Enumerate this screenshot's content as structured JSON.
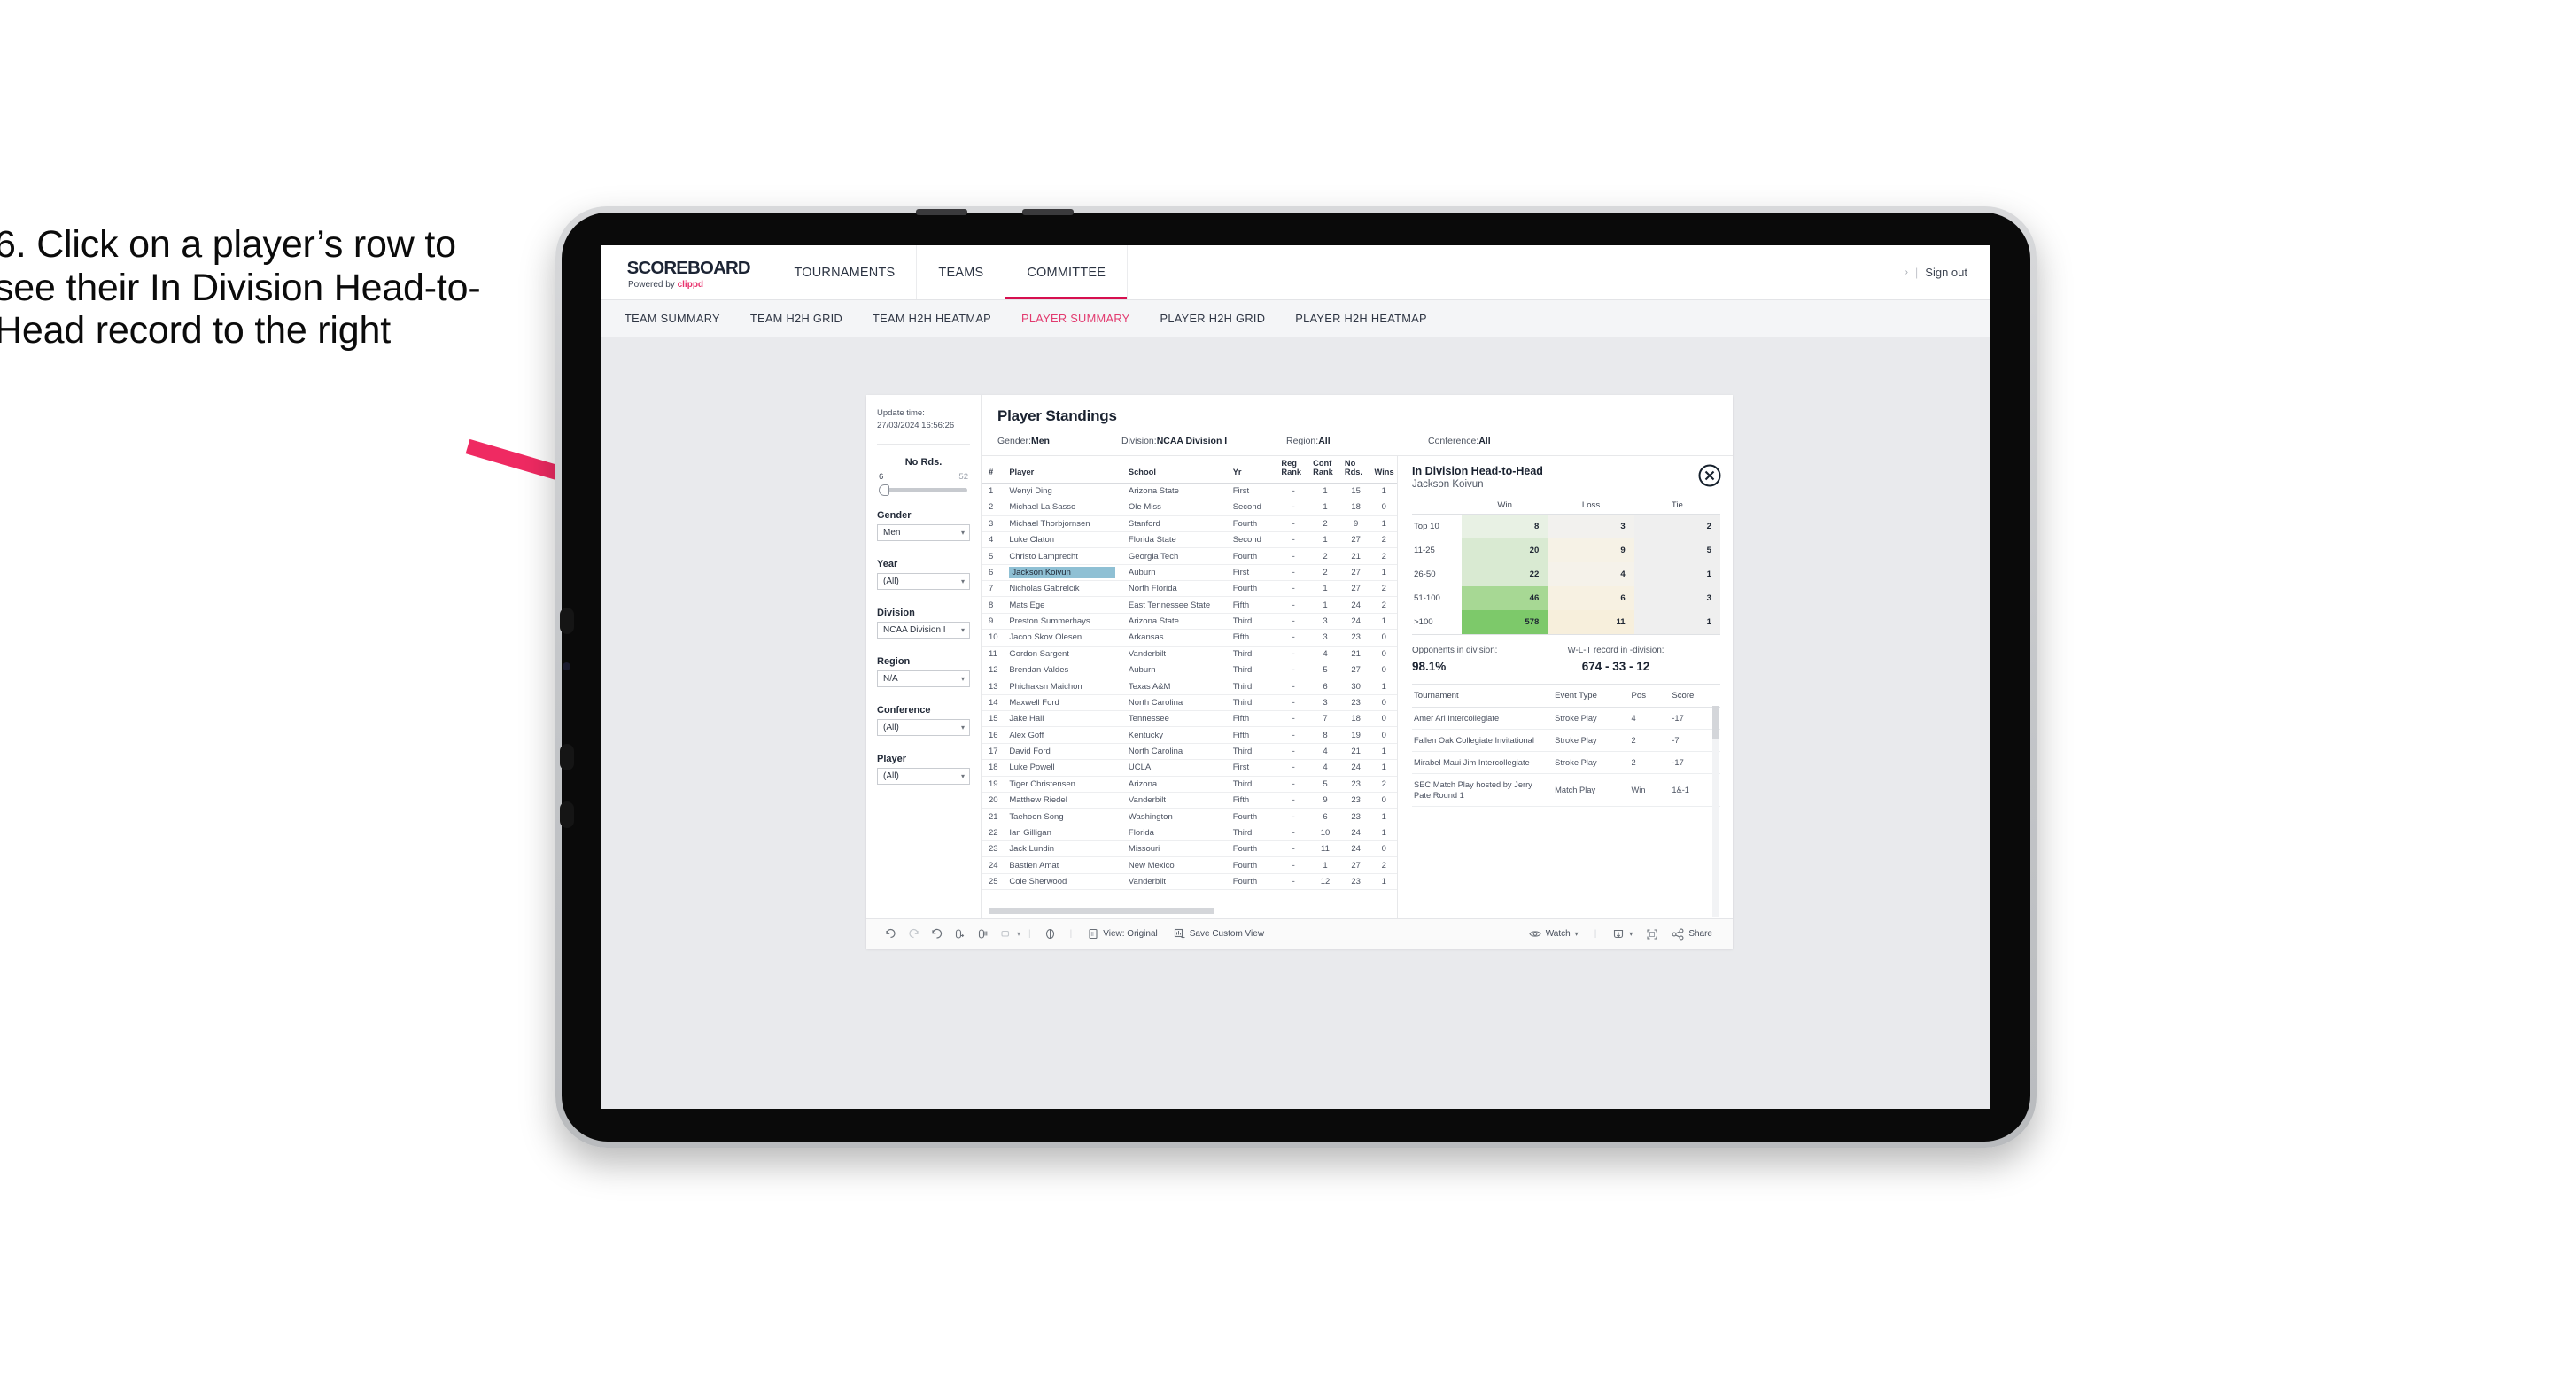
{
  "caption": {
    "text": "6. Click on a player’s row to see their In Division Head-to-Head record to the right"
  },
  "header": {
    "brand_title": "SCOREBOARD",
    "brand_sub_prefix": "Powered by ",
    "brand_sub_name": "clippd",
    "nav": [
      {
        "label": "TOURNAMENTS",
        "active": false
      },
      {
        "label": "TEAMS",
        "active": false
      },
      {
        "label": "COMMITTEE",
        "active": true
      }
    ],
    "chevron": "›",
    "separator": "|",
    "sign_out": "Sign out"
  },
  "subnav": [
    {
      "label": "TEAM SUMMARY",
      "active": false
    },
    {
      "label": "TEAM H2H GRID",
      "active": false
    },
    {
      "label": "TEAM H2H HEATMAP",
      "active": false
    },
    {
      "label": "PLAYER SUMMARY",
      "active": true
    },
    {
      "label": "PLAYER H2H GRID",
      "active": false
    },
    {
      "label": "PLAYER H2H HEATMAP",
      "active": false
    }
  ],
  "rail": {
    "update_label": "Update time:",
    "update_value": "27/03/2024 16:56:26",
    "slider": {
      "title": "No Rds.",
      "min": "6",
      "max": "52"
    },
    "filters": [
      {
        "label": "Gender",
        "value": "Men"
      },
      {
        "label": "Year",
        "value": "(All)"
      },
      {
        "label": "Division",
        "value": "NCAA Division I"
      },
      {
        "label": "Region",
        "value": "N/A"
      },
      {
        "label": "Conference",
        "value": "(All)"
      },
      {
        "label": "Player",
        "value": "(All)"
      }
    ],
    "caret": "▾"
  },
  "standings": {
    "title": "Player Standings",
    "meta": [
      {
        "label": "Gender: ",
        "value": "Men"
      },
      {
        "label": "Division: ",
        "value": "NCAA Division I"
      },
      {
        "label": "Region: ",
        "value": "All"
      },
      {
        "label": "Conference: ",
        "value": "All"
      }
    ],
    "columns": [
      "#",
      "Player",
      "School",
      "Yr",
      "Reg Rank",
      "Conf Rank",
      "No Rds.",
      "Wins"
    ],
    "rows": [
      {
        "num": "1",
        "player": "Wenyi Ding",
        "school": "Arizona State",
        "yr": "First",
        "reg": "-",
        "conf": "1",
        "rds": "15",
        "wins": "1",
        "selected": false
      },
      {
        "num": "2",
        "player": "Michael La Sasso",
        "school": "Ole Miss",
        "yr": "Second",
        "reg": "-",
        "conf": "1",
        "rds": "18",
        "wins": "0",
        "selected": false
      },
      {
        "num": "3",
        "player": "Michael Thorbjornsen",
        "school": "Stanford",
        "yr": "Fourth",
        "reg": "-",
        "conf": "2",
        "rds": "9",
        "wins": "1",
        "selected": false
      },
      {
        "num": "4",
        "player": "Luke Claton",
        "school": "Florida State",
        "yr": "Second",
        "reg": "-",
        "conf": "1",
        "rds": "27",
        "wins": "2",
        "selected": false
      },
      {
        "num": "5",
        "player": "Christo Lamprecht",
        "school": "Georgia Tech",
        "yr": "Fourth",
        "reg": "-",
        "conf": "2",
        "rds": "21",
        "wins": "2",
        "selected": false
      },
      {
        "num": "6",
        "player": "Jackson Koivun",
        "school": "Auburn",
        "yr": "First",
        "reg": "-",
        "conf": "2",
        "rds": "27",
        "wins": "1",
        "selected": true
      },
      {
        "num": "7",
        "player": "Nicholas Gabrelcik",
        "school": "North Florida",
        "yr": "Fourth",
        "reg": "-",
        "conf": "1",
        "rds": "27",
        "wins": "2",
        "selected": false
      },
      {
        "num": "8",
        "player": "Mats Ege",
        "school": "East Tennessee State",
        "yr": "Fifth",
        "reg": "-",
        "conf": "1",
        "rds": "24",
        "wins": "2",
        "selected": false
      },
      {
        "num": "9",
        "player": "Preston Summerhays",
        "school": "Arizona State",
        "yr": "Third",
        "reg": "-",
        "conf": "3",
        "rds": "24",
        "wins": "1",
        "selected": false
      },
      {
        "num": "10",
        "player": "Jacob Skov Olesen",
        "school": "Arkansas",
        "yr": "Fifth",
        "reg": "-",
        "conf": "3",
        "rds": "23",
        "wins": "0",
        "selected": false
      },
      {
        "num": "11",
        "player": "Gordon Sargent",
        "school": "Vanderbilt",
        "yr": "Third",
        "reg": "-",
        "conf": "4",
        "rds": "21",
        "wins": "0",
        "selected": false
      },
      {
        "num": "12",
        "player": "Brendan Valdes",
        "school": "Auburn",
        "yr": "Third",
        "reg": "-",
        "conf": "5",
        "rds": "27",
        "wins": "0",
        "selected": false
      },
      {
        "num": "13",
        "player": "Phichaksn Maichon",
        "school": "Texas A&M",
        "yr": "Third",
        "reg": "-",
        "conf": "6",
        "rds": "30",
        "wins": "1",
        "selected": false
      },
      {
        "num": "14",
        "player": "Maxwell Ford",
        "school": "North Carolina",
        "yr": "Third",
        "reg": "-",
        "conf": "3",
        "rds": "23",
        "wins": "0",
        "selected": false
      },
      {
        "num": "15",
        "player": "Jake Hall",
        "school": "Tennessee",
        "yr": "Fifth",
        "reg": "-",
        "conf": "7",
        "rds": "18",
        "wins": "0",
        "selected": false
      },
      {
        "num": "16",
        "player": "Alex Goff",
        "school": "Kentucky",
        "yr": "Fifth",
        "reg": "-",
        "conf": "8",
        "rds": "19",
        "wins": "0",
        "selected": false
      },
      {
        "num": "17",
        "player": "David Ford",
        "school": "North Carolina",
        "yr": "Third",
        "reg": "-",
        "conf": "4",
        "rds": "21",
        "wins": "1",
        "selected": false
      },
      {
        "num": "18",
        "player": "Luke Powell",
        "school": "UCLA",
        "yr": "First",
        "reg": "-",
        "conf": "4",
        "rds": "24",
        "wins": "1",
        "selected": false
      },
      {
        "num": "19",
        "player": "Tiger Christensen",
        "school": "Arizona",
        "yr": "Third",
        "reg": "-",
        "conf": "5",
        "rds": "23",
        "wins": "2",
        "selected": false
      },
      {
        "num": "20",
        "player": "Matthew Riedel",
        "school": "Vanderbilt",
        "yr": "Fifth",
        "reg": "-",
        "conf": "9",
        "rds": "23",
        "wins": "0",
        "selected": false
      },
      {
        "num": "21",
        "player": "Taehoon Song",
        "school": "Washington",
        "yr": "Fourth",
        "reg": "-",
        "conf": "6",
        "rds": "23",
        "wins": "1",
        "selected": false
      },
      {
        "num": "22",
        "player": "Ian Gilligan",
        "school": "Florida",
        "yr": "Third",
        "reg": "-",
        "conf": "10",
        "rds": "24",
        "wins": "1",
        "selected": false
      },
      {
        "num": "23",
        "player": "Jack Lundin",
        "school": "Missouri",
        "yr": "Fourth",
        "reg": "-",
        "conf": "11",
        "rds": "24",
        "wins": "0",
        "selected": false
      },
      {
        "num": "24",
        "player": "Bastien Amat",
        "school": "New Mexico",
        "yr": "Fourth",
        "reg": "-",
        "conf": "1",
        "rds": "27",
        "wins": "2",
        "selected": false
      },
      {
        "num": "25",
        "player": "Cole Sherwood",
        "school": "Vanderbilt",
        "yr": "Fourth",
        "reg": "-",
        "conf": "12",
        "rds": "23",
        "wins": "1",
        "selected": false
      }
    ]
  },
  "h2h": {
    "title": "In Division Head-to-Head",
    "subtitle": "Jackson Koivun",
    "close_icon": "close-icon",
    "columns": [
      "",
      "Win",
      "Loss",
      "Tie"
    ],
    "rows": [
      {
        "band": "Top 10",
        "win": "8",
        "loss": "3",
        "tie": "2",
        "win_color": "#e8f1e4",
        "loss_color": "#f2f1ee"
      },
      {
        "band": "11-25",
        "win": "20",
        "loss": "9",
        "tie": "5",
        "win_color": "#d9ead2",
        "loss_color": "#f6f2e6"
      },
      {
        "band": "26-50",
        "win": "22",
        "loss": "4",
        "tie": "1",
        "win_color": "#d9ead2",
        "loss_color": "#f5f2ea"
      },
      {
        "band": "51-100",
        "win": "46",
        "loss": "6",
        "tie": "3",
        "win_color": "#a7d894",
        "loss_color": "#f7f1e2"
      },
      {
        "band": ">100",
        "win": "578",
        "loss": "11",
        "tie": "1",
        "win_color": "#7dc96a",
        "loss_color": "#f7efdc"
      }
    ],
    "tie_color": "#efefef",
    "stats": [
      {
        "label": "Opponents in division:",
        "value": "98.1%"
      },
      {
        "label": "W-L-T record in -division:",
        "value": "674 - 33 - 12"
      }
    ],
    "tour_columns": [
      "Tournament",
      "Event Type",
      "Pos",
      "Score"
    ],
    "tour_rows": [
      {
        "name": "Amer Ari Intercollegiate",
        "type": "Stroke Play",
        "pos": "4",
        "score": "-17"
      },
      {
        "name": "Fallen Oak Collegiate Invitational",
        "type": "Stroke Play",
        "pos": "2",
        "score": "-7"
      },
      {
        "name": "Mirabel Maui Jim Intercollegiate",
        "type": "Stroke Play",
        "pos": "2",
        "score": "-17"
      },
      {
        "name": "SEC Match Play hosted by Jerry Pate Round 1",
        "type": "Match Play",
        "pos": "Win",
        "score": "1&-1"
      }
    ]
  },
  "toolbar": {
    "icons": [
      "undo-icon",
      "redo-icon",
      "revert-icon",
      "refresh-data-icon",
      "pause-updates-icon",
      "tooltip-icon"
    ],
    "icon_caret": "▾",
    "history_icon": "history-icon",
    "view_label": "View: Original",
    "view_icon": "view-original-icon",
    "save_label": "Save Custom View",
    "save_icon": "save-view-icon",
    "watch_label": "Watch",
    "watch_icon": "eye-icon",
    "download_icon": "download-icon",
    "fullscreen_icon": "fullscreen-icon",
    "share_label": "Share",
    "share_icon": "share-icon",
    "sep": "|"
  },
  "colors": {
    "accent": "#e23a6f",
    "arrow": "#ef2a62",
    "selected_row": "#8fc0d4"
  }
}
